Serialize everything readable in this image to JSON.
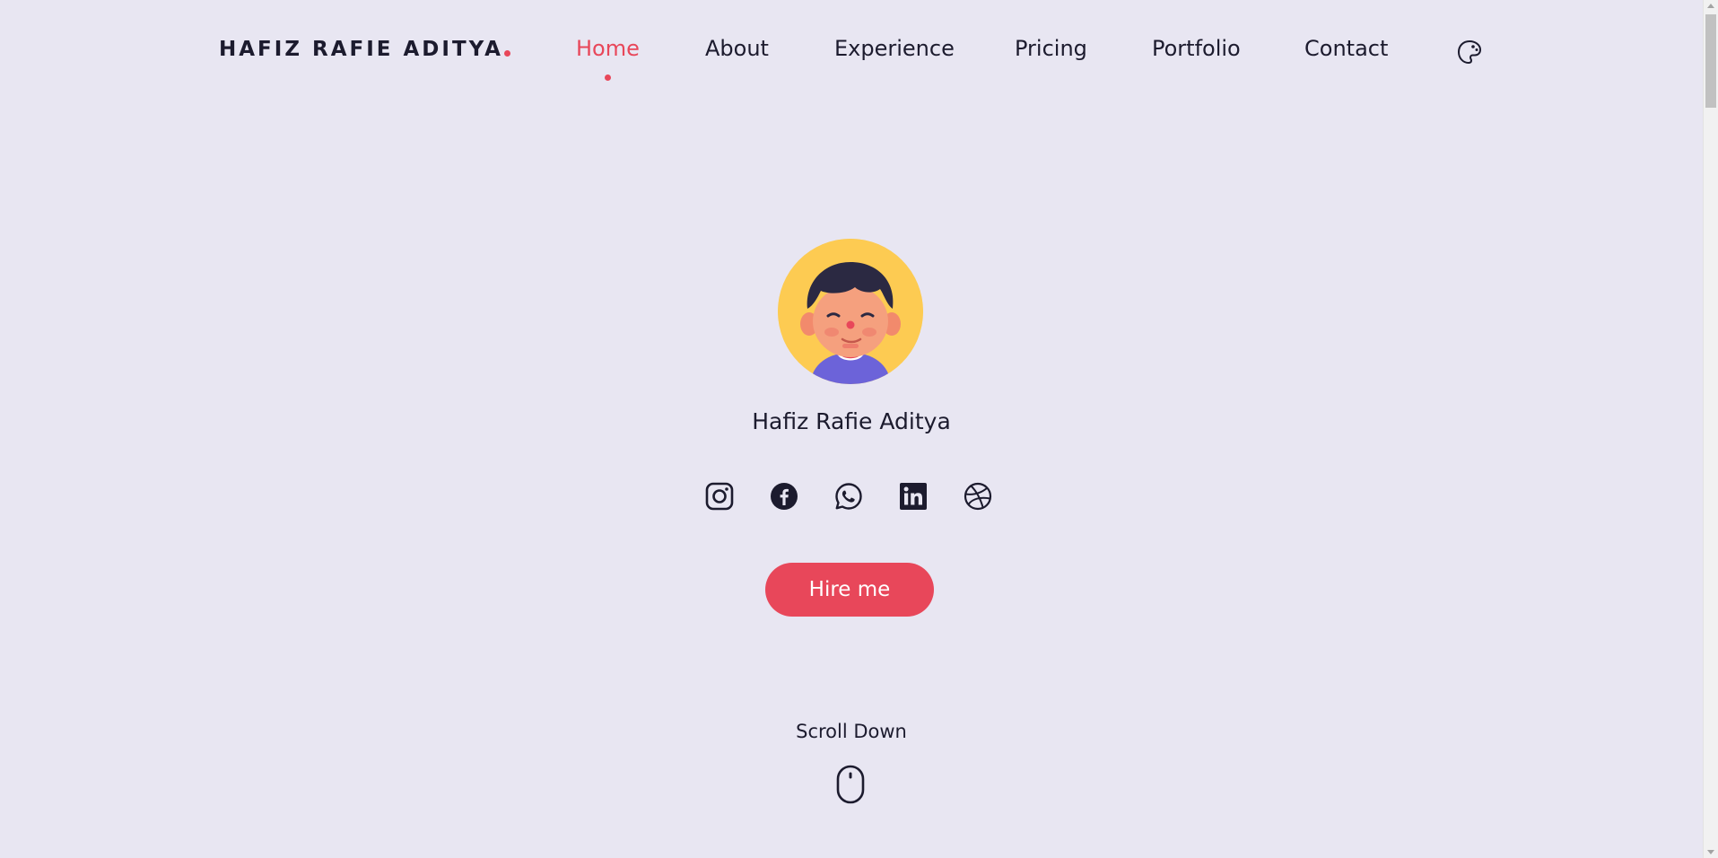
{
  "header": {
    "logo_text": "HAFIZ RAFIE ADITYA",
    "nav": [
      {
        "label": "Home",
        "active": true
      },
      {
        "label": "About",
        "active": false
      },
      {
        "label": "Experience",
        "active": false
      },
      {
        "label": "Pricing",
        "active": false
      },
      {
        "label": "Portfolio",
        "active": false
      },
      {
        "label": "Contact",
        "active": false
      }
    ],
    "theme_toggle_icon": "palette-icon"
  },
  "hero": {
    "avatar_icon": "avatar-illustration",
    "name": "Hafiz Rafie Aditya",
    "socials": [
      {
        "name": "instagram-icon"
      },
      {
        "name": "facebook-icon"
      },
      {
        "name": "whatsapp-icon"
      },
      {
        "name": "linkedin-icon"
      },
      {
        "name": "dribbble-icon"
      }
    ],
    "cta_label": "Hire me"
  },
  "scroll": {
    "label": "Scroll Down",
    "icon": "mouse-icon"
  },
  "colors": {
    "background": "#e8e6f2",
    "accent": "#e8475a",
    "text": "#1c1b2e",
    "avatar_bg": "#fdcb52"
  }
}
